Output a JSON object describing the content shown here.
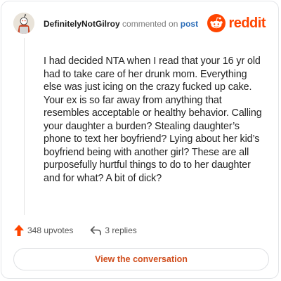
{
  "header": {
    "username": "DefinitelyNotGilroy",
    "action": "commented on",
    "post_link": "post"
  },
  "brand": {
    "name": "reddit",
    "logo_icon": "reddit-snoo-icon",
    "color": "#ff4500"
  },
  "comment": {
    "text": "I had decided NTA when I read that your 16 yr old had to take care of her drunk mom. Everything else was just icing on the crazy fucked up cake. Your ex is so far away from anything that resembles acceptable or healthy behavior. Calling your daughter a burden? Stealing daughter’s phone to text her boyfriend? Lying about her kid’s boyfriend being with another girl? These are all purposefully hurtful things to do to her daughter and for what? A bit of dick?"
  },
  "stats": {
    "upvotes": "348 upvotes",
    "replies": "3 replies",
    "upvote_icon": "upvote-arrow-icon",
    "reply_icon": "reply-arrow-icon",
    "upvote_color": "#ff4500"
  },
  "cta": {
    "label": "View the conversation",
    "color": "#d04d1c"
  }
}
